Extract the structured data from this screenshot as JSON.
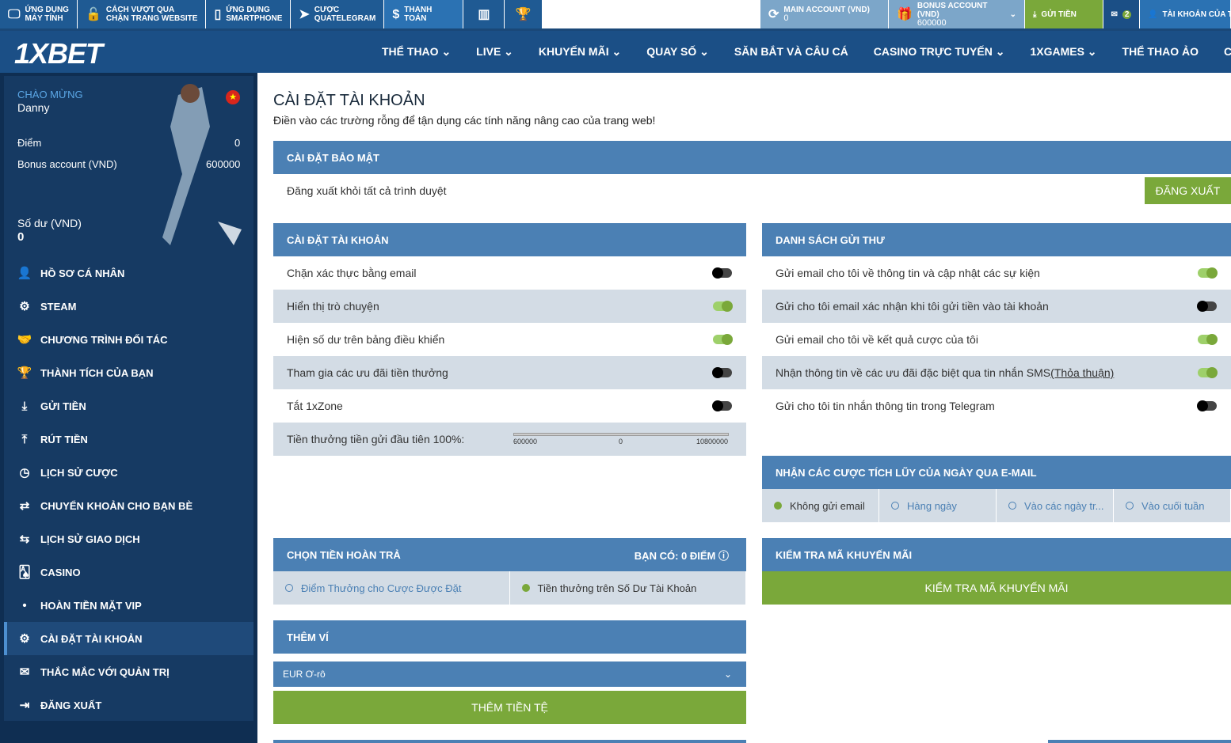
{
  "topbar": {
    "items": [
      {
        "icon": "monitor-icon",
        "glyph": "🖵",
        "label1": "ỨNG DỤNG",
        "label2": "MÁY TÍNH"
      },
      {
        "icon": "unlock-icon",
        "glyph": "🔓",
        "label1": "CÁCH VƯỢT QUA",
        "label2": "CHẶN TRANG WEBSITE"
      },
      {
        "icon": "smartphone-icon",
        "glyph": "▯",
        "label1": "ỨNG DỤNG",
        "label2": "SMARTPHONE"
      },
      {
        "icon": "telegram-icon",
        "glyph": "➤",
        "label1": "CƯỢC",
        "label2": "QUATELEGRAM"
      },
      {
        "icon": "dollar-icon",
        "glyph": "$",
        "label1": "THANH TOÁN",
        "label2": ""
      }
    ],
    "main_account_label": "MAIN ACCOUNT (VND)",
    "main_account_value": "0",
    "bonus_account_label": "BONUS ACCOUNT (VND)",
    "bonus_account_value": "600000",
    "deposit_label": "GỬI TIỀN",
    "messages_count": "2",
    "account_label": "TÀI KHOẢN CỦA T"
  },
  "header": {
    "logo": "1XBET",
    "nav": [
      "THỂ THAO ⌄",
      "LIVE ⌄",
      "KHUYẾN MÃI ⌄",
      "QUAY SỐ ⌄",
      "SĂN BẮT VÀ CÂU CÁ",
      "CASINO TRỰC TUYẾN ⌄",
      "1XGAMES ⌄",
      "THỂ THAO ẢO",
      "CÁC TRÒ C"
    ]
  },
  "sidebar": {
    "welcome": "CHÀO MỪNG",
    "username": "Danny",
    "points_label": "Điểm",
    "points_value": "0",
    "bonus_label": "Bonus account (VND)",
    "bonus_value": "600000",
    "balance_label": "Số dư (VND)",
    "balance_value": "0",
    "items": [
      {
        "icon": "profile-icon",
        "glyph": "👤",
        "label": "HỒ SƠ CÁ NHÂN"
      },
      {
        "icon": "steam-icon",
        "glyph": "⚙",
        "label": "STEAM"
      },
      {
        "icon": "handshake-icon",
        "glyph": "🤝",
        "label": "CHƯƠNG TRÌNH ĐỐI TÁC"
      },
      {
        "icon": "trophy-icon",
        "glyph": "🏆",
        "label": "THÀNH TÍCH CỦA BẠN"
      },
      {
        "icon": "download-icon",
        "glyph": "⤓",
        "label": "GỬI TIỀN"
      },
      {
        "icon": "upload-icon",
        "glyph": "⤒",
        "label": "RÚT TIỀN"
      },
      {
        "icon": "clock-icon",
        "glyph": "◷",
        "label": "LỊCH SỬ CƯỢC"
      },
      {
        "icon": "transfer-icon",
        "glyph": "⇄",
        "label": "CHUYỂN KHOẢN CHO BẠN BÈ"
      },
      {
        "icon": "exchange-icon",
        "glyph": "⇆",
        "label": "LỊCH SỬ GIAO DỊCH"
      },
      {
        "icon": "cards-icon",
        "glyph": "🂡",
        "label": "CASINO"
      },
      {
        "icon": "bullet-icon",
        "glyph": "•",
        "label": "HOÀN TIỀN MẶT VIP"
      },
      {
        "icon": "gears-icon",
        "glyph": "⚙",
        "label": "CÀI ĐẶT TÀI KHOẢN"
      },
      {
        "icon": "mail-icon",
        "glyph": "✉",
        "label": "THẮC MẮC VỚI QUẢN TRỊ"
      },
      {
        "icon": "logout-icon",
        "glyph": "⇥",
        "label": "ĐĂNG XUẤT"
      }
    ]
  },
  "main": {
    "title": "CÀI ĐẶT TÀI KHOẢN",
    "subtitle": "Điền vào các trường rỗng để tận dụng các tính năng nâng cao của trang web!",
    "security": {
      "header": "CÀI ĐẶT BẢO MẬT",
      "text": "Đăng xuất khỏi tất cả trình duyệt",
      "button": "ĐĂNG XUẤT"
    },
    "account": {
      "header": "CÀI ĐẶT TÀI KHOẢN",
      "rows": [
        {
          "label": "Chặn xác thực bằng email",
          "on": false
        },
        {
          "label": "Hiển thị trò chuyện",
          "on": true
        },
        {
          "label": "Hiện số dư trên bảng điều khiển",
          "on": true
        },
        {
          "label": "Tham gia các ưu đãi tiền thưởng",
          "on": false
        },
        {
          "label": "Tắt 1xZone",
          "on": false
        }
      ],
      "bonus_label": "Tiền thưởng tiền gửi đầu tiên 100%:",
      "slider_min": "600000",
      "slider_mid": "0",
      "slider_max": "10800000"
    },
    "mailing": {
      "header": "DANH SÁCH GỬI THƯ",
      "rows": [
        {
          "label": "Gửi email cho tôi về thông tin và cập nhật các sự kiện",
          "on": true
        },
        {
          "label": "Gửi cho tôi email xác nhận khi tôi gửi tiền vào tài khoản",
          "on": false
        },
        {
          "label": "Gửi email cho tôi về kết quả cược của tôi",
          "on": true
        },
        {
          "label": "Nhận thông tin về các ưu đãi đặc biệt qua tin nhắn SMS",
          "link": "(Thỏa thuận)",
          "on": true
        },
        {
          "label": "Gửi cho tôi tin nhắn thông tin trong Telegram",
          "on": false
        }
      ]
    },
    "daily": {
      "header": "NHẬN CÁC CƯỢC TÍCH LŨY CỦA NGÀY QUA E-MAIL",
      "options": [
        "Không gửi email",
        "Hàng ngày",
        "Vào các ngày tr...",
        "Vào cuối tuần"
      ],
      "selected": 0
    },
    "cashback": {
      "header": "CHỌN TIỀN HOÀN TRẢ",
      "points": "BẠN CÓ: 0 ĐIỂM",
      "options": [
        "Điểm Thưởng cho Cược Được Đặt",
        "Tiền thưởng trên Số Dư Tài Khoản"
      ],
      "selected": 1
    },
    "promo": {
      "header": "KIỂM TRA MÃ KHUYẾN MÃI",
      "button": "KIỂM TRA MÃ KHUYẾN MÃI"
    },
    "wallet": {
      "header": "THÊM VÍ",
      "currency": "EUR Ơ-rô",
      "button": "THÊM TIỀN TỆ"
    }
  },
  "colors": {
    "primary": "#1b4f86",
    "section": "#4b80b4",
    "green": "#7aa83a",
    "row_alt": "#d3dce5"
  }
}
